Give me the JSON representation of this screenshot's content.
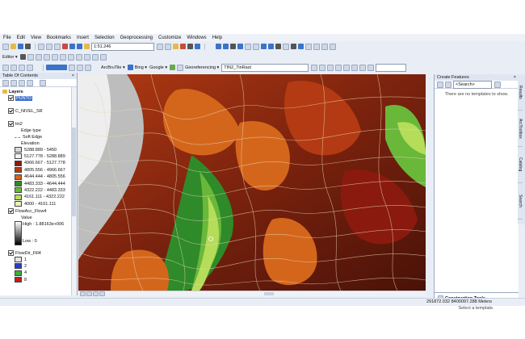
{
  "menu": [
    "File",
    "Edit",
    "View",
    "Bookmarks",
    "Insert",
    "Selection",
    "Geoprocessing",
    "Customize",
    "Windows",
    "Help"
  ],
  "toolbar": {
    "scale_value": "1:51.246",
    "editor_label": "Editor ▾",
    "basemap_label": "ArcBruTile ▾",
    "bing_label": "Bing ▾",
    "google_label": "Google ▾",
    "georef_label": "Georeferencing ▾",
    "georef_layer": "TIN2_TinRast"
  },
  "toc": {
    "title": "Table Of Contents",
    "close": "×",
    "layers": "Layers",
    "punto": "PUNTO",
    "nivel": "C_NIVEL_SR",
    "tin": "tin2",
    "edge_type": "Edge type",
    "soft_edge": "Soft Edge",
    "elevation": "Elevation",
    "classes": [
      {
        "label": "5288.889 - 5450",
        "color": "#d9d9d9"
      },
      {
        "label": "5127.778 - 5288.889",
        "color": "#f2f2f2"
      },
      {
        "label": "4966.667 - 5127.778",
        "color": "#8a1a0e"
      },
      {
        "label": "4805.556 - 4966.667",
        "color": "#b33a12"
      },
      {
        "label": "4644.444 - 4805.556",
        "color": "#d4661c"
      },
      {
        "label": "4483.333 - 4644.444",
        "color": "#2f8a2a"
      },
      {
        "label": "4322.222 - 4483.333",
        "color": "#69b83a"
      },
      {
        "label": "4161.111 - 4322.222",
        "color": "#b5dd5a"
      },
      {
        "label": "4000 - 4161.111",
        "color": "#e7f2b4"
      }
    ],
    "flowacc": "FlowAcc_Flow4",
    "value": "Value",
    "high": "High : 1.88163e+006",
    "low": "Low : 0",
    "flowdir": "FlowDir_Fill4",
    "flowdir_classes": [
      {
        "label": "1",
        "color": "#e6e6e6"
      },
      {
        "label": "2",
        "color": "#2b3bd1"
      },
      {
        "label": "4",
        "color": "#39b039"
      },
      {
        "label": "8",
        "color": "#c41d1d"
      }
    ]
  },
  "create_features": {
    "title": "Create Features",
    "search": "<Search>",
    "empty": "There are no templates to show.",
    "construction_tools": "Construction Tools",
    "select_template": "Select a template."
  },
  "side_tabs": [
    "Results",
    "ArcToolbox",
    "Catalog",
    "Search"
  ],
  "status": {
    "coords": "291872.032  8400097.288 Meters"
  }
}
